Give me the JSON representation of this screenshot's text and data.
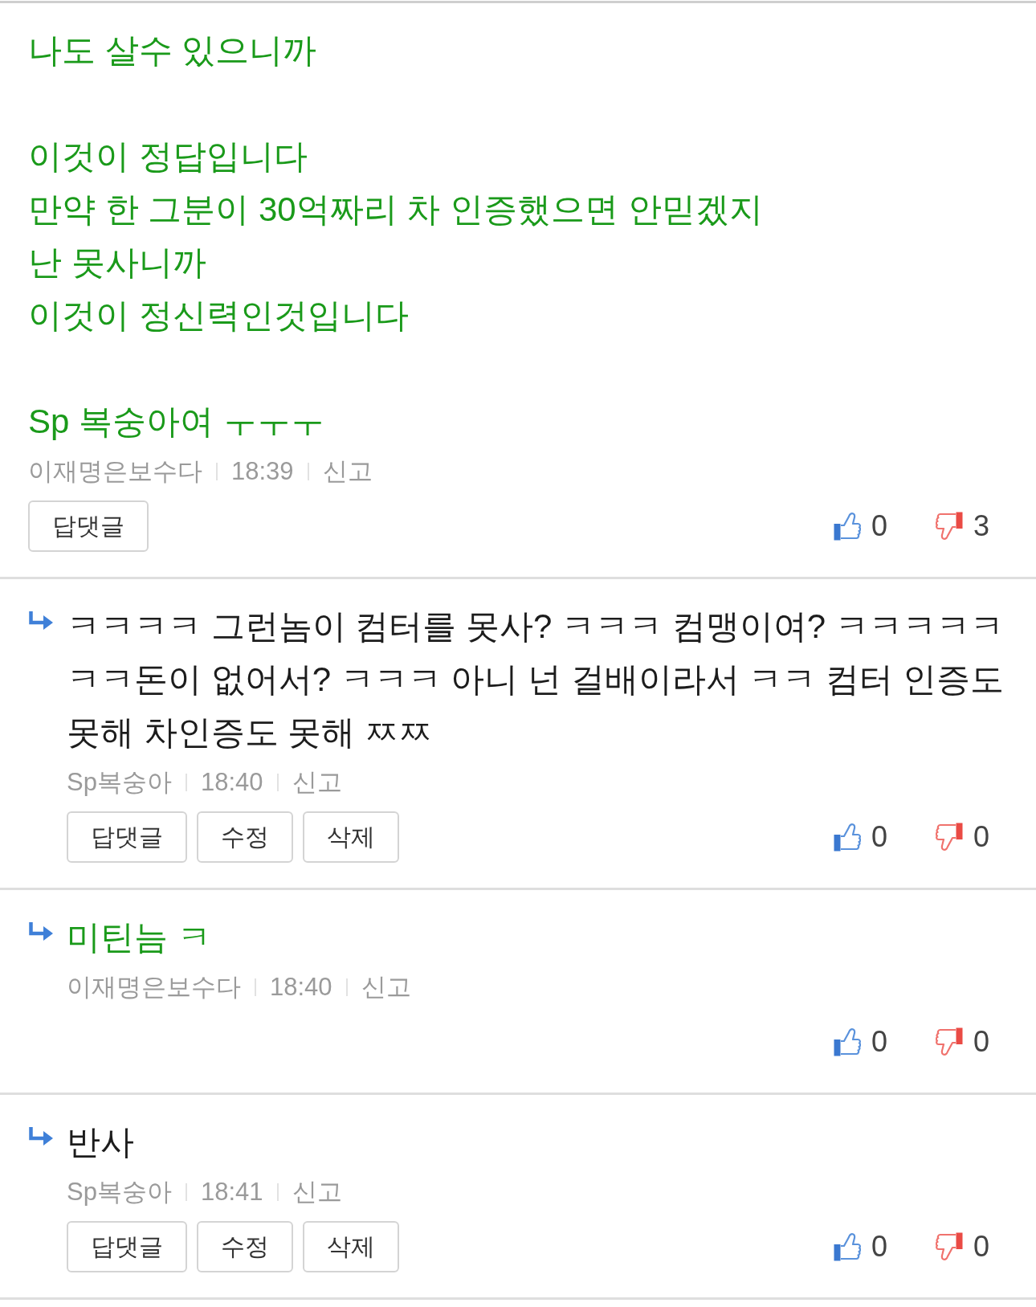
{
  "comments": [
    {
      "reply": false,
      "color": "#1a9a1a",
      "paragraphs": [
        [
          "나도 살수 있으니까"
        ],
        [
          "이것이 정답입니다",
          "만약 한 그분이 30억짜리 차 인증했으면 안믿겠지",
          "난 못사니까",
          "이것이 정신력인것입니다"
        ],
        [
          "Sp 복숭아여 ㅜㅜㅜ"
        ]
      ],
      "author": "이재명은보수다",
      "time": "18:39",
      "report": "신고",
      "buttons": [
        "답댓글"
      ],
      "likes": "0",
      "dislikes": "3"
    },
    {
      "reply": true,
      "color": "#1c1c1c",
      "paragraphs": [
        [
          "ㅋㅋㅋㅋ 그런놈이 컴터를 못사? ㅋㅋㅋ 컴맹이여? ㅋㅋㅋㅋㅋㅋㅋ돈이 없어서? ㅋㅋㅋ 아니 넌 걸배이라서 ㅋㅋ 컴터 인증도 못해 차인증도 못해 ㅉㅉ"
        ]
      ],
      "author": "Sp복숭아",
      "time": "18:40",
      "report": "신고",
      "buttons": [
        "답댓글",
        "수정",
        "삭제"
      ],
      "likes": "0",
      "dislikes": "0"
    },
    {
      "reply": true,
      "color": "#1a9a1a",
      "paragraphs": [
        [
          "미틴늠 ㅋ"
        ]
      ],
      "author": "이재명은보수다",
      "time": "18:40",
      "report": "신고",
      "likes": "0",
      "dislikes": "0"
    },
    {
      "reply": true,
      "color": "#1c1c1c",
      "paragraphs": [
        [
          "반사"
        ]
      ],
      "author": "Sp복숭아",
      "time": "18:41",
      "report": "신고",
      "buttons": [
        "답댓글",
        "수정",
        "삭제"
      ],
      "likes": "0",
      "dislikes": "0"
    }
  ]
}
